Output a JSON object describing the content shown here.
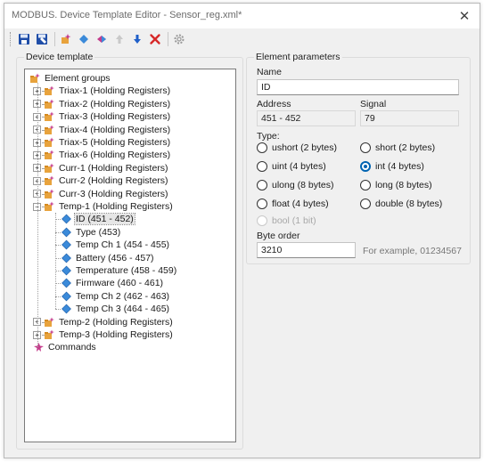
{
  "window": {
    "title": "MODBUS. Device Template Editor - Sensor_reg.xml*"
  },
  "tree": {
    "group_title": "Device template",
    "root_label": "Element groups",
    "groups": [
      {
        "label": "Triax-1 (Holding Registers)"
      },
      {
        "label": "Triax-2 (Holding Registers)"
      },
      {
        "label": "Triax-3 (Holding Registers)"
      },
      {
        "label": "Triax-4 (Holding Registers)"
      },
      {
        "label": "Triax-5 (Holding Registers)"
      },
      {
        "label": "Triax-6 (Holding Registers)"
      },
      {
        "label": "Curr-1 (Holding Registers)"
      },
      {
        "label": "Curr-2 (Holding Registers)"
      },
      {
        "label": "Curr-3 (Holding Registers)"
      },
      {
        "label": "Temp-1 (Holding Registers)"
      }
    ],
    "temp1_items": [
      {
        "label": "ID (451 - 452)"
      },
      {
        "label": "Type (453)"
      },
      {
        "label": "Temp Ch 1 (454 - 455)"
      },
      {
        "label": "Battery (456 - 457)"
      },
      {
        "label": "Temperature (458 - 459)"
      },
      {
        "label": "Firmware (460 - 461)"
      },
      {
        "label": "Temp Ch 2 (462 - 463)"
      },
      {
        "label": "Temp Ch 3 (464 - 465)"
      }
    ],
    "more_groups": [
      {
        "label": "Temp-2 (Holding Registers)"
      },
      {
        "label": "Temp-3 (Holding Registers)"
      }
    ],
    "commands_label": "Commands"
  },
  "params": {
    "group_title": "Element parameters",
    "name_label": "Name",
    "name_value": "ID",
    "address_label": "Address",
    "address_value": "451 - 452",
    "signal_label": "Signal",
    "signal_value": "79",
    "type_label": "Type:",
    "types": {
      "ushort": "ushort (2 bytes)",
      "short": "short (2 bytes)",
      "uint": "uint (4 bytes)",
      "int": "int (4 bytes)",
      "ulong": "ulong (8 bytes)",
      "long": "long (8 bytes)",
      "float": "float (4 bytes)",
      "double": "double (8 bytes)",
      "bool": "bool (1 bit)"
    },
    "selected_type": "int",
    "byte_order_label": "Byte order",
    "byte_order_value": "3210",
    "byte_order_hint": "For example, 01234567"
  },
  "colors": {
    "accent": "#0063b1",
    "folder_icon": "#e8a33d",
    "element_icon": "#3b8ad9",
    "delete_icon": "#d62828"
  }
}
